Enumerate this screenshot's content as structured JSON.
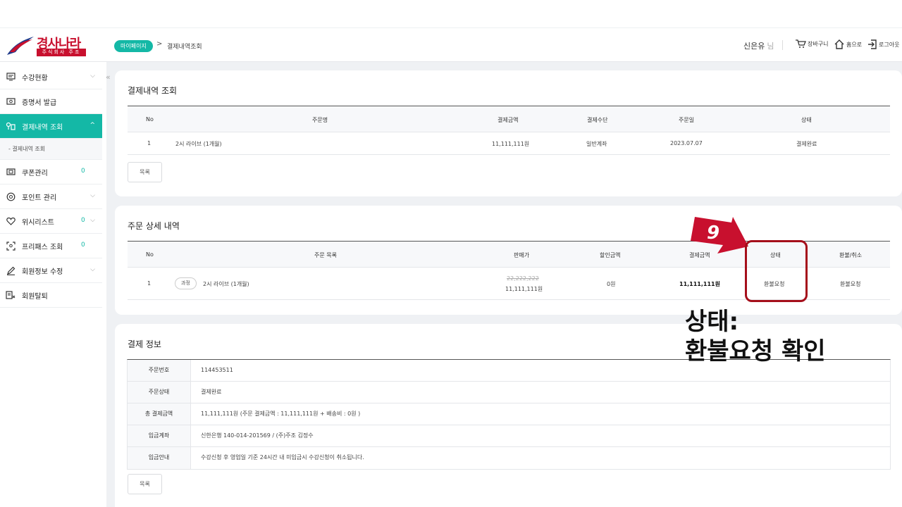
{
  "brand": {
    "name": "경사나라",
    "sub": "주식회사 주조"
  },
  "breadcrumb": {
    "pill": "마이페이지",
    "separator": ">",
    "current": "결제내역조회"
  },
  "header": {
    "user_name": "신은유",
    "user_suffix": "님",
    "cart": "장바구니",
    "home": "홈으로",
    "logout": "로그아웃"
  },
  "sidebar": {
    "collapse": "«",
    "items": [
      {
        "label": "수강현황",
        "icon": "monitor-icon",
        "chev": "⌵"
      },
      {
        "label": "증명서 발급",
        "icon": "certificate-icon"
      },
      {
        "label": "결제내역 조회",
        "icon": "payment-icon",
        "chev": "^"
      },
      {
        "label": "쿠폰관리",
        "icon": "coupon-icon",
        "count": "0"
      },
      {
        "label": "포인트 관리",
        "icon": "point-icon",
        "chev": "⌵"
      },
      {
        "label": "위시리스트",
        "icon": "heart-icon",
        "count": "0",
        "chev": "⌵"
      },
      {
        "label": "프리패스 조회",
        "icon": "scan-icon",
        "count": "0"
      },
      {
        "label": "회원정보 수정",
        "icon": "pencil-icon",
        "chev": "⌵"
      },
      {
        "label": "회원탈퇴",
        "icon": "withdraw-icon"
      }
    ],
    "sub_item": "- 결제내역 조회"
  },
  "payments": {
    "title": "결제내역 조회",
    "headers": [
      "No",
      "주문명",
      "결제금액",
      "결제수단",
      "주문일",
      "상태"
    ],
    "rows": [
      {
        "no": "1",
        "name": "2시 라이브 (1개월)",
        "amount": "11,111,111원",
        "method": "일반계좌",
        "date": "2023.07.07",
        "status": "결제완료"
      }
    ],
    "list_button": "목록"
  },
  "detail": {
    "title": "주문 상세 내역",
    "headers": [
      "No",
      "주문 목록",
      "판매가",
      "할인금액",
      "결제금액",
      "상태",
      "환불/취소"
    ],
    "rows": [
      {
        "no": "1",
        "tag": "과정",
        "name": "2시 라이브 (1개월)",
        "orig_price": "22,222,222",
        "price": "11,111,111원",
        "discount": "0원",
        "paid": "11,111,111원",
        "status": "환불요청",
        "refund": "환불요청"
      }
    ]
  },
  "payinfo": {
    "title": "결제 정보",
    "rows": [
      {
        "k": "주문번호",
        "v": "114453511"
      },
      {
        "k": "주문상태",
        "v": "결제완료"
      },
      {
        "k": "총 결제금액",
        "v": "11,111,111원 (주문 결제금액 : 11,111,111원 + 배송비 : 0원 )"
      },
      {
        "k": "입금계좌",
        "v": "신한은행 140-014-201569 / (주)주조 김정수"
      },
      {
        "k": "입금안내",
        "v": "수강신청 후 영업일 기준 24시간 내 미입금시 수강신청이 취소됩니다."
      }
    ],
    "list_button": "목록"
  },
  "annotation": {
    "step": "9",
    "line1": "상태:",
    "line2": "환불요청 확인"
  },
  "colors": {
    "accent": "#14b8a6",
    "brand": "#c8102e",
    "annotation": "#a50f1b"
  }
}
